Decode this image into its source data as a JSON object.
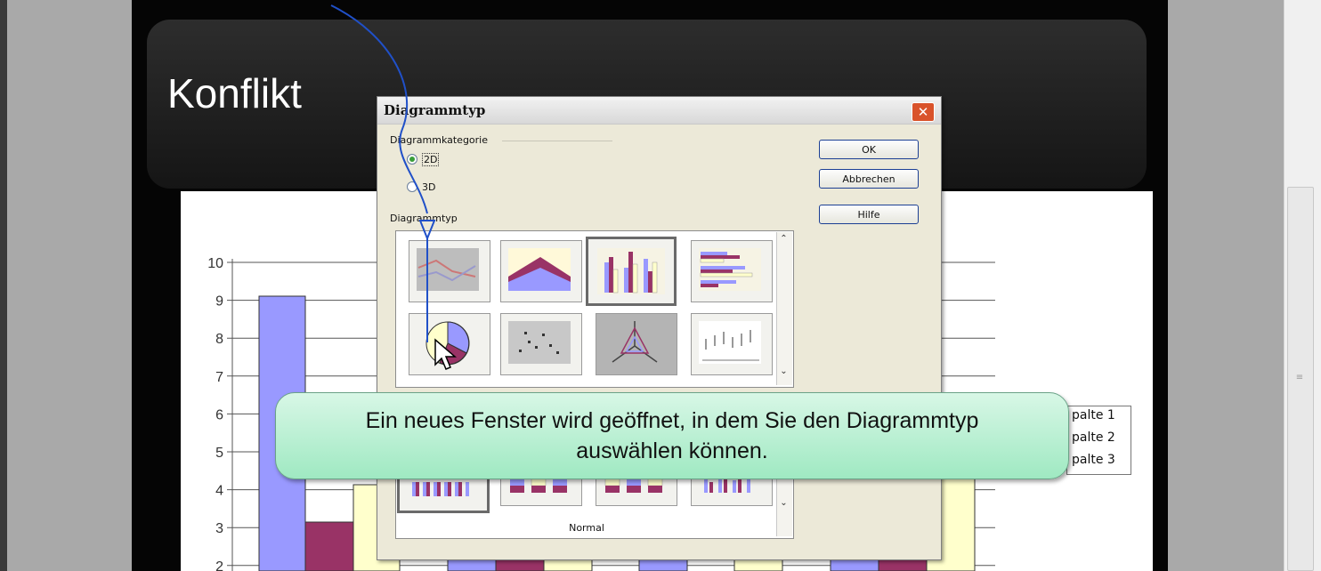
{
  "slide": {
    "title": "Konflikt"
  },
  "chart_data": {
    "type": "bar",
    "y_ticks": [
      "10",
      "9",
      "8",
      "7",
      "6",
      "5",
      "4",
      "3",
      "2"
    ],
    "legend": [
      "palte 1",
      "palte 2",
      "palte 3"
    ],
    "colors": [
      "#9999ff",
      "#993366",
      "#ffffcc"
    ]
  },
  "dialog": {
    "title": "Diagrammtyp",
    "category_group": "Diagrammkategorie",
    "radio_2d": "2D",
    "radio_3d": "3D",
    "type_label": "Diagrammtyp",
    "ok": "OK",
    "cancel": "Abbrechen",
    "help": "Hilfe",
    "variant_caption": "Normal",
    "chart_types": [
      "line-chart-icon",
      "area-chart-icon",
      "column-chart-icon",
      "bar-chart-icon",
      "pie-chart-icon",
      "xy-scatter-icon",
      "net-chart-icon",
      "stock-chart-icon"
    ]
  },
  "callout": {
    "line1": "Ein neues Fenster wird geöffnet, in dem Sie den Diagrammtyp",
    "line2": "auswählen können."
  }
}
